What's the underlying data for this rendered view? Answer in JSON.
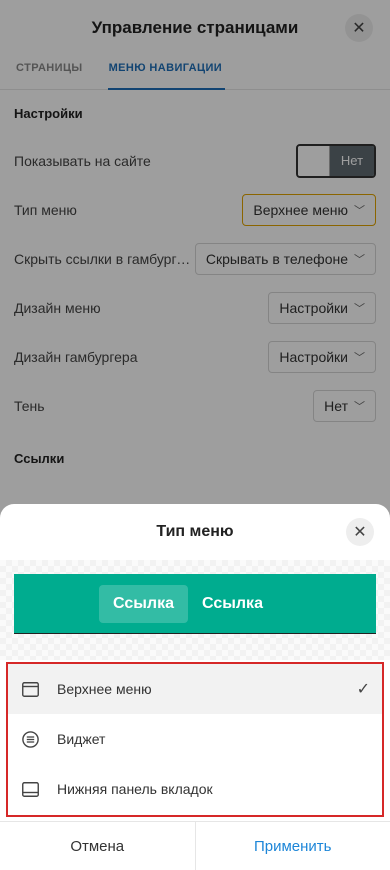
{
  "panel": {
    "title": "Управление страницами",
    "tabs": [
      {
        "label": "СТРАНИЦЫ",
        "active": false
      },
      {
        "label": "МЕНЮ НАВИГАЦИИ",
        "active": true
      }
    ],
    "settings_title": "Настройки",
    "rows": {
      "show_on_site": {
        "label": "Показывать на сайте",
        "toggle_value": "Нет"
      },
      "menu_type": {
        "label": "Тип меню",
        "value": "Верхнее меню"
      },
      "hide_links": {
        "label": "Скрыть ссылки в гамбургере",
        "value": "Скрывать в телефоне"
      },
      "menu_design": {
        "label": "Дизайн меню",
        "value": "Настройки"
      },
      "hamburger_design": {
        "label": "Дизайн гамбургера",
        "value": "Настройки"
      },
      "shadow": {
        "label": "Тень",
        "value": "Нет"
      }
    },
    "links_title": "Ссылки"
  },
  "sheet": {
    "title": "Тип меню",
    "preview": {
      "links": [
        "Ссылка",
        "Ссылка"
      ],
      "bar_color": "#00ac8f"
    },
    "options": [
      {
        "label": "Верхнее меню",
        "icon": "browser-window-icon",
        "selected": true
      },
      {
        "label": "Виджет",
        "icon": "list-circle-icon",
        "selected": false
      },
      {
        "label": "Нижняя панель вкладок",
        "icon": "bottom-bar-icon",
        "selected": false
      }
    ],
    "cancel_label": "Отмена",
    "apply_label": "Применить"
  },
  "colors": {
    "accent": "#1d6fb8",
    "apply": "#1d86d8",
    "highlight_border": "#d62828",
    "select_highlight": "#e0a400"
  }
}
